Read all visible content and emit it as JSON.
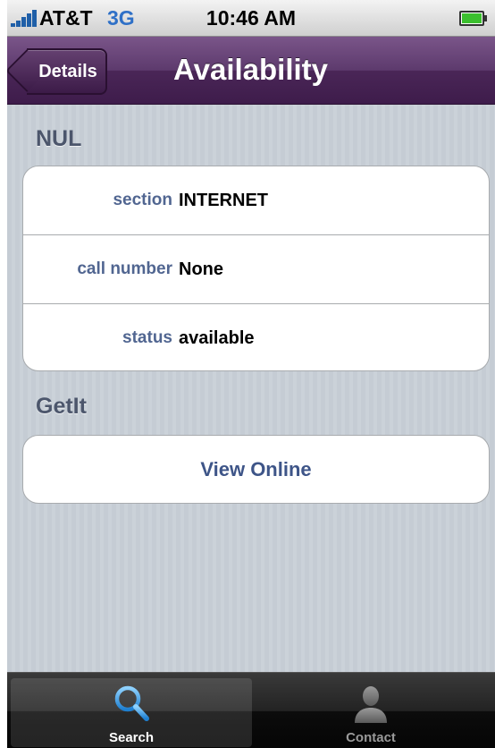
{
  "status_bar": {
    "carrier": "AT&T",
    "network": "3G",
    "time": "10:46 AM"
  },
  "nav": {
    "back_label": "Details",
    "title": "Availability"
  },
  "sections": [
    {
      "header": "NUL",
      "rows": [
        {
          "label": "section",
          "value": "INTERNET"
        },
        {
          "label": "call number",
          "value": "None"
        },
        {
          "label": "status",
          "value": "available"
        }
      ]
    },
    {
      "header": "GetIt",
      "action_label": "View Online"
    }
  ],
  "tab_bar": {
    "tabs": [
      {
        "label": "Search",
        "icon": "search-icon",
        "selected": true
      },
      {
        "label": "Contact",
        "icon": "contact-icon",
        "selected": false
      }
    ]
  },
  "colors": {
    "nav_bar": "#4a2657",
    "background": "#c5ccd4",
    "label_text": "#516691",
    "action_text": "#3e5588",
    "search_icon": "#3aa0e6"
  }
}
